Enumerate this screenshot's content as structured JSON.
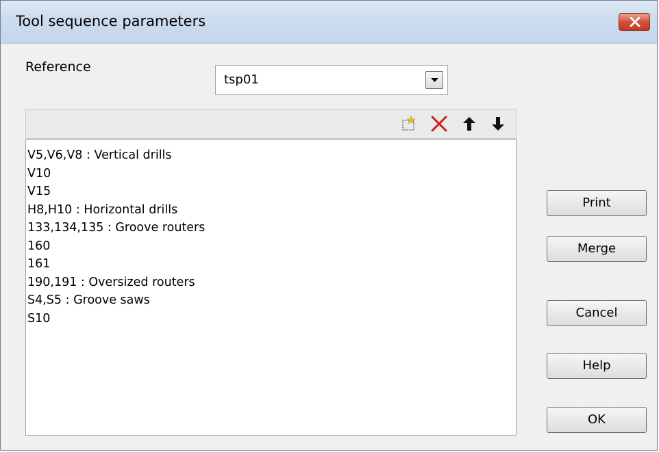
{
  "window": {
    "title": "Tool sequence parameters",
    "close_icon": "close-icon"
  },
  "reference": {
    "label": "Reference",
    "value": "tsp01"
  },
  "toolbar": {
    "icons": [
      "new-item-icon",
      "delete-icon",
      "move-up-icon",
      "move-down-icon"
    ],
    "delete_color": "#cc1f1f"
  },
  "sequence": {
    "items": [
      "V5,V6,V8 : Vertical drills",
      "V10",
      "V15",
      "H8,H10 : Horizontal drills",
      "133,134,135 : Groove routers",
      "160",
      "161",
      "190,191 : Oversized routers",
      "S4,S5 : Groove saws",
      "S10"
    ]
  },
  "buttons": {
    "print": "Print",
    "merge": "Merge",
    "cancel": "Cancel",
    "help": "Help",
    "ok": "OK"
  }
}
